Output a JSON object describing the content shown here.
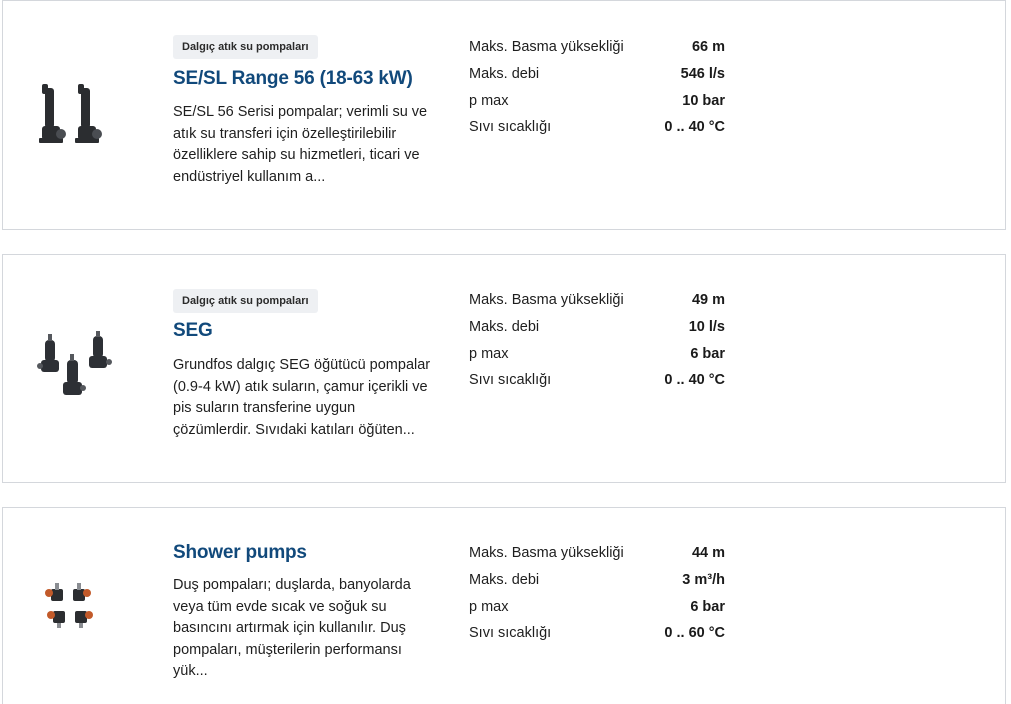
{
  "products": [
    {
      "badge": "Dalgıç atık su pompaları",
      "title": "SE/SL Range 56 (18-63 kW)",
      "description": "SE/SL 56 Serisi pompalar; verimli su ve atık su transferi için özelleştirilebilir özelliklere sahip su hizmetleri, ticari ve endüstriyel kullanım a...",
      "image": "pump-image",
      "specs": [
        {
          "label": "Maks. Basma yüksekliği",
          "value": "66 m"
        },
        {
          "label": "Maks. debi",
          "value": "546 l/s"
        },
        {
          "label": "p max",
          "value": "10 bar"
        },
        {
          "label": "Sıvı sıcaklığı",
          "value": "0 .. 40 °C"
        }
      ]
    },
    {
      "badge": "Dalgıç atık su pompaları",
      "title": "SEG",
      "description": "Grundfos dalgıç SEG öğütücü pompalar (0.9-4 kW) atık suların, çamur içerikli ve pis suların transferine uygun çözümlerdir. Sıvıdaki katıları öğüten...",
      "image": "pump-image",
      "specs": [
        {
          "label": "Maks. Basma yüksekliği",
          "value": "49 m"
        },
        {
          "label": "Maks. debi",
          "value": "10 l/s"
        },
        {
          "label": "p max",
          "value": "6 bar"
        },
        {
          "label": "Sıvı sıcaklığı",
          "value": "0 .. 40 °C"
        }
      ]
    },
    {
      "title": "Shower pumps",
      "description": "Duş pompaları; duşlarda, banyolarda veya tüm evde sıcak ve soğuk su basıncını artırmak için kullanılır. Duş pompaları, müşterilerin performansı yük...",
      "image": "pump-image",
      "specs": [
        {
          "label": "Maks. Basma yüksekliği",
          "value": "44 m"
        },
        {
          "label": "Maks. debi",
          "value": "3 m³/h"
        },
        {
          "label": "p max",
          "value": "6 bar"
        },
        {
          "label": "Sıvı sıcaklığı",
          "value": "0 .. 60 °C"
        }
      ]
    }
  ],
  "colors": {
    "title": "#11497b",
    "badge_bg": "#eef0f3",
    "border": "#d4d7dc"
  }
}
